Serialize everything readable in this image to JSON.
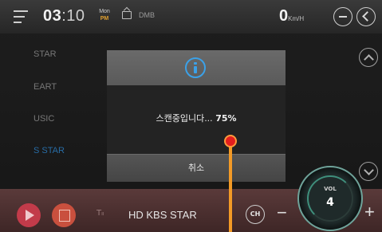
{
  "statusbar": {
    "clock_hour": "03",
    "clock_minute": ":10",
    "day": "Mon",
    "ampm": "PM",
    "source": "DMB",
    "speed_value": "0",
    "speed_unit": "Km/H"
  },
  "channel_list": {
    "items": [
      {
        "label": "STAR"
      },
      {
        "label": "EART"
      },
      {
        "label": "USIC"
      },
      {
        "label": "S STAR",
        "active": true
      }
    ]
  },
  "dialog": {
    "message": "스캔중입니다...",
    "progress_percent": "75%",
    "cancel_label": "취소"
  },
  "bottombar": {
    "station_name": "HD KBS STAR",
    "ch_label": "CH",
    "vol_label": "VOL",
    "vol_value": "4",
    "minus_label": "−",
    "plus_label": "+"
  },
  "colors": {
    "accent_blue": "#3ba1e8",
    "active_channel": "#2f7fc2",
    "marker_red": "#e31e1e",
    "marker_orange": "#f39a26"
  },
  "icons": [
    "menu-icon",
    "tv-icon",
    "minimize-icon",
    "back-icon",
    "chevron-up-icon",
    "chevron-down-icon",
    "info-icon",
    "play-icon",
    "grid-icon",
    "antenna-icon"
  ]
}
